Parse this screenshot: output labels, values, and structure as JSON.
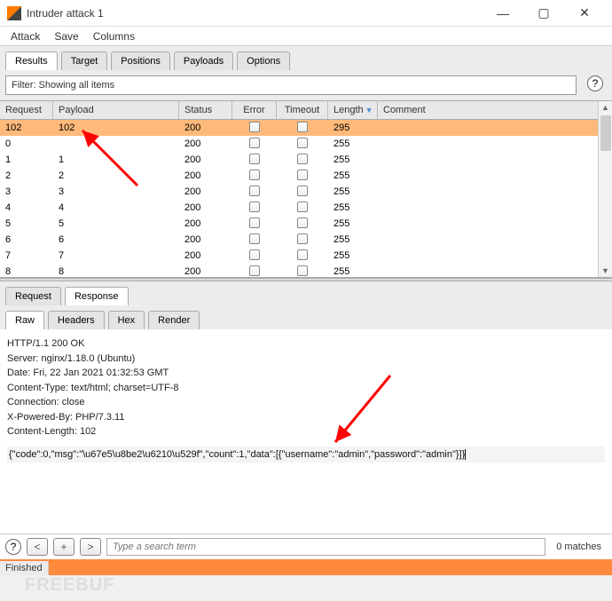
{
  "window": {
    "title": "Intruder attack 1"
  },
  "menu": [
    "Attack",
    "Save",
    "Columns"
  ],
  "main_tabs": {
    "items": [
      "Results",
      "Target",
      "Positions",
      "Payloads",
      "Options"
    ],
    "active": 0
  },
  "filter_text": "Filter: Showing all items",
  "columns": {
    "request": "Request",
    "payload": "Payload",
    "status": "Status",
    "error": "Error",
    "timeout": "Timeout",
    "length": "Length",
    "comment": "Comment",
    "sorted": "length"
  },
  "rows": [
    {
      "request": "102",
      "payload": "102",
      "status": "200",
      "length": "295",
      "selected": true
    },
    {
      "request": "0",
      "payload": "",
      "status": "200",
      "length": "255"
    },
    {
      "request": "1",
      "payload": "1",
      "status": "200",
      "length": "255"
    },
    {
      "request": "2",
      "payload": "2",
      "status": "200",
      "length": "255"
    },
    {
      "request": "3",
      "payload": "3",
      "status": "200",
      "length": "255"
    },
    {
      "request": "4",
      "payload": "4",
      "status": "200",
      "length": "255"
    },
    {
      "request": "5",
      "payload": "5",
      "status": "200",
      "length": "255"
    },
    {
      "request": "6",
      "payload": "6",
      "status": "200",
      "length": "255"
    },
    {
      "request": "7",
      "payload": "7",
      "status": "200",
      "length": "255"
    },
    {
      "request": "8",
      "payload": "8",
      "status": "200",
      "length": "255"
    }
  ],
  "detail_tabs": {
    "items": [
      "Request",
      "Response"
    ],
    "active": 1
  },
  "detail_tabs2": {
    "items": [
      "Raw",
      "Headers",
      "Hex",
      "Render"
    ],
    "active": 0
  },
  "raw": {
    "headers": [
      "HTTP/1.1 200 OK",
      "Server: nginx/1.18.0 (Ubuntu)",
      "Date: Fri, 22 Jan 2021 01:32:53 GMT",
      "Content-Type: text/html; charset=UTF-8",
      "Connection: close",
      "X-Powered-By: PHP/7.3.11",
      "Content-Length: 102"
    ],
    "body": "{\"code\":0,\"msg\":\"\\u67e5\\u8be2\\u6210\\u529f\",\"count\":1,\"data\":[{\"username\":\"admin\",\"password\":\"admin\"}]}"
  },
  "search": {
    "placeholder": "Type a search term",
    "matches": "0 matches"
  },
  "status": "Finished",
  "watermark": "FREEBUF"
}
